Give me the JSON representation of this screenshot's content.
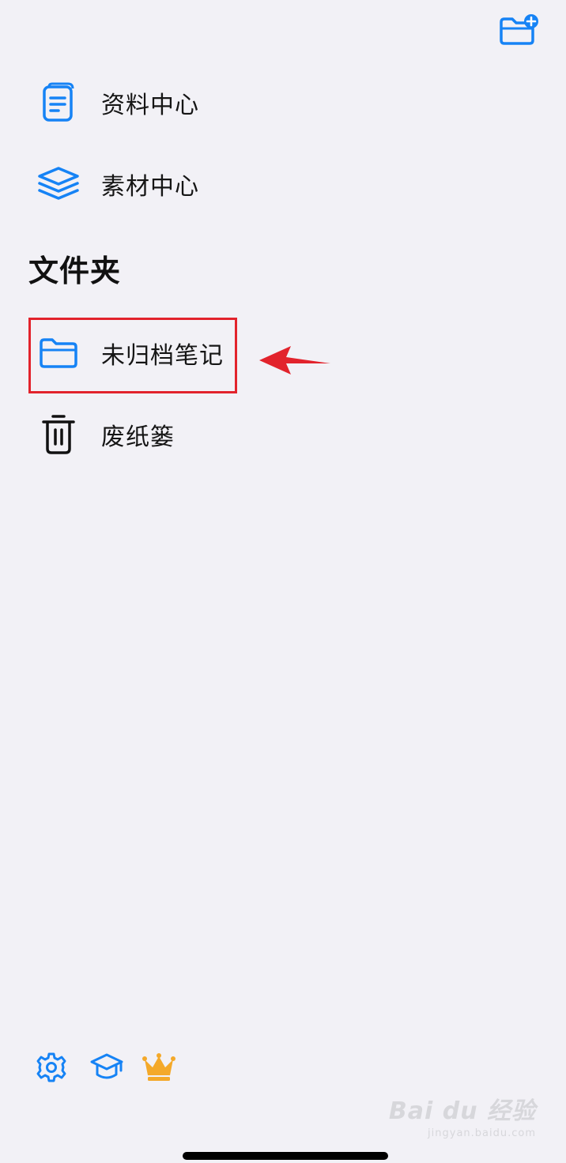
{
  "colors": {
    "background": "#f2f1f6",
    "accent": "#1683f5",
    "crown": "#f4a92a",
    "annotation": "#e2232c",
    "text": "#151515"
  },
  "header": {
    "new_folder_icon": "folder-plus-icon"
  },
  "nav": {
    "items": [
      {
        "label": "资料中心",
        "icon": "document-icon"
      },
      {
        "label": "素材中心",
        "icon": "layers-icon"
      }
    ]
  },
  "folders": {
    "title": "文件夹",
    "items": [
      {
        "label": "未归档笔记",
        "icon": "folder-icon",
        "highlighted": true
      },
      {
        "label": "废纸篓",
        "icon": "trash-icon"
      }
    ]
  },
  "footer": {
    "icons": [
      "gear-icon",
      "graduation-cap-icon",
      "crown-icon"
    ]
  },
  "watermark": {
    "main": "Bai du 经验",
    "sub": "jingyan.baidu.com"
  }
}
